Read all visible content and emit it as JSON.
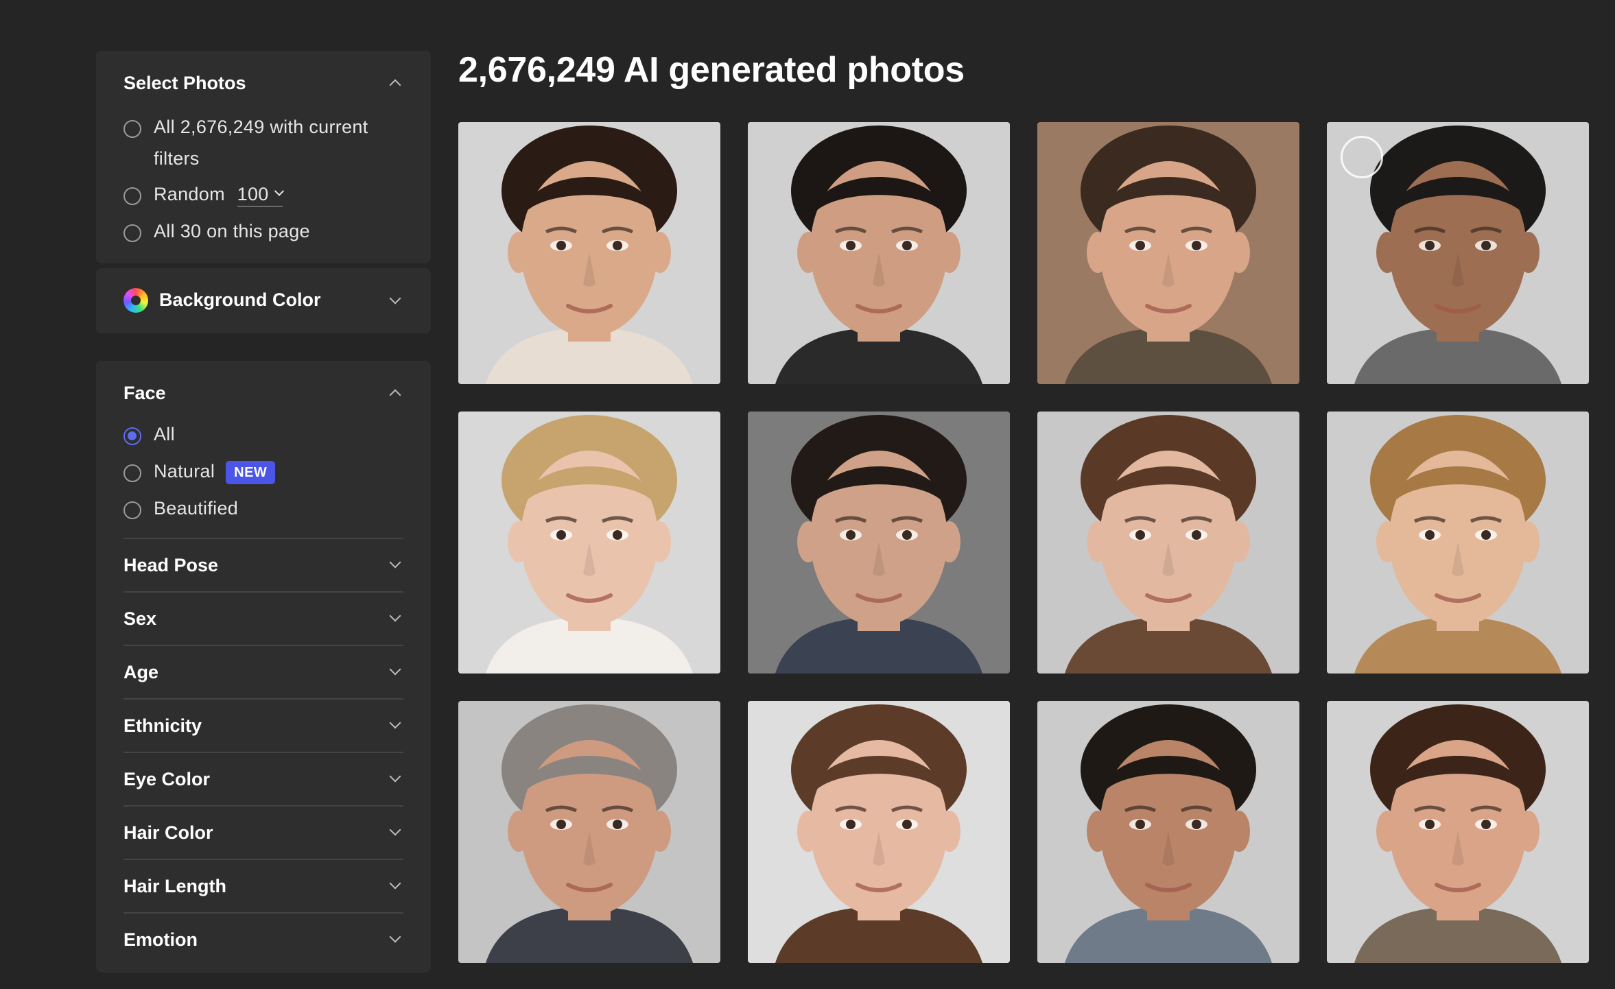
{
  "header": {
    "title": "2,676,249 AI generated photos"
  },
  "select_photos": {
    "title": "Select Photos",
    "options": [
      {
        "label": "All 2,676,249 with current filters",
        "line1": "All 2,676,249 with current",
        "line2": "filters",
        "checked": false
      },
      {
        "label": "Random",
        "dropdown_value": "100",
        "checked": false
      },
      {
        "label": "All 30 on this page",
        "checked": false
      }
    ]
  },
  "background_color": {
    "title": "Background Color",
    "icon": "color-wheel-icon"
  },
  "face": {
    "title": "Face",
    "options": [
      {
        "label": "All",
        "checked": true
      },
      {
        "label": "Natural",
        "badge": "NEW",
        "checked": false
      },
      {
        "label": "Beautified",
        "checked": false
      }
    ],
    "filters": [
      "Head Pose",
      "Sex",
      "Age",
      "Ethnicity",
      "Eye Color",
      "Hair Color",
      "Hair Length",
      "Emotion"
    ]
  },
  "colors": {
    "page_bg": "#252525",
    "panel_bg": "#2e2e2e",
    "accent": "#5b6cf0",
    "badge_bg": "#4b55e8"
  },
  "photos": [
    {
      "bg": "#d4d4d4",
      "skin": "#d9a98a",
      "hair": "#2a1c14",
      "shirt": "#e8ddd2"
    },
    {
      "bg": "#d0d0d0",
      "skin": "#cf9e82",
      "hair": "#1c1714",
      "shirt": "#2a2a2a"
    },
    {
      "bg": "#9a7a62",
      "skin": "#d8a588",
      "hair": "#3b2a1f",
      "shirt": "#5e5040"
    },
    {
      "bg": "#cfcfcf",
      "skin": "#9e6e52",
      "hair": "#1c1a18",
      "shirt": "#6a6a6a",
      "selectable": true
    },
    {
      "bg": "#d8d8d8",
      "skin": "#eac3ad",
      "hair": "#c7a46e",
      "shirt": "#f2efea"
    },
    {
      "bg": "#7c7c7c",
      "skin": "#cfa188",
      "hair": "#211a16",
      "shirt": "#3b4252"
    },
    {
      "bg": "#c8c8c8",
      "skin": "#e2b8a0",
      "hair": "#5a3a26",
      "shirt": "#6b4a35"
    },
    {
      "bg": "#cdcdcd",
      "skin": "#e4b99a",
      "hair": "#a77a45",
      "shirt": "#b58a58"
    },
    {
      "bg": "#c4c4c4",
      "skin": "#cf9b80",
      "hair": "#8a8480",
      "shirt": "#3d4048"
    },
    {
      "bg": "#dedede",
      "skin": "#e6b9a2",
      "hair": "#5c3c28",
      "shirt": "#5c3c28"
    },
    {
      "bg": "#cbcbcb",
      "skin": "#b98468",
      "hair": "#1e1915",
      "shirt": "#6f7b88"
    },
    {
      "bg": "#d2d2d2",
      "skin": "#d9a488",
      "hair": "#3c2518",
      "shirt": "#7a6a5a"
    }
  ]
}
